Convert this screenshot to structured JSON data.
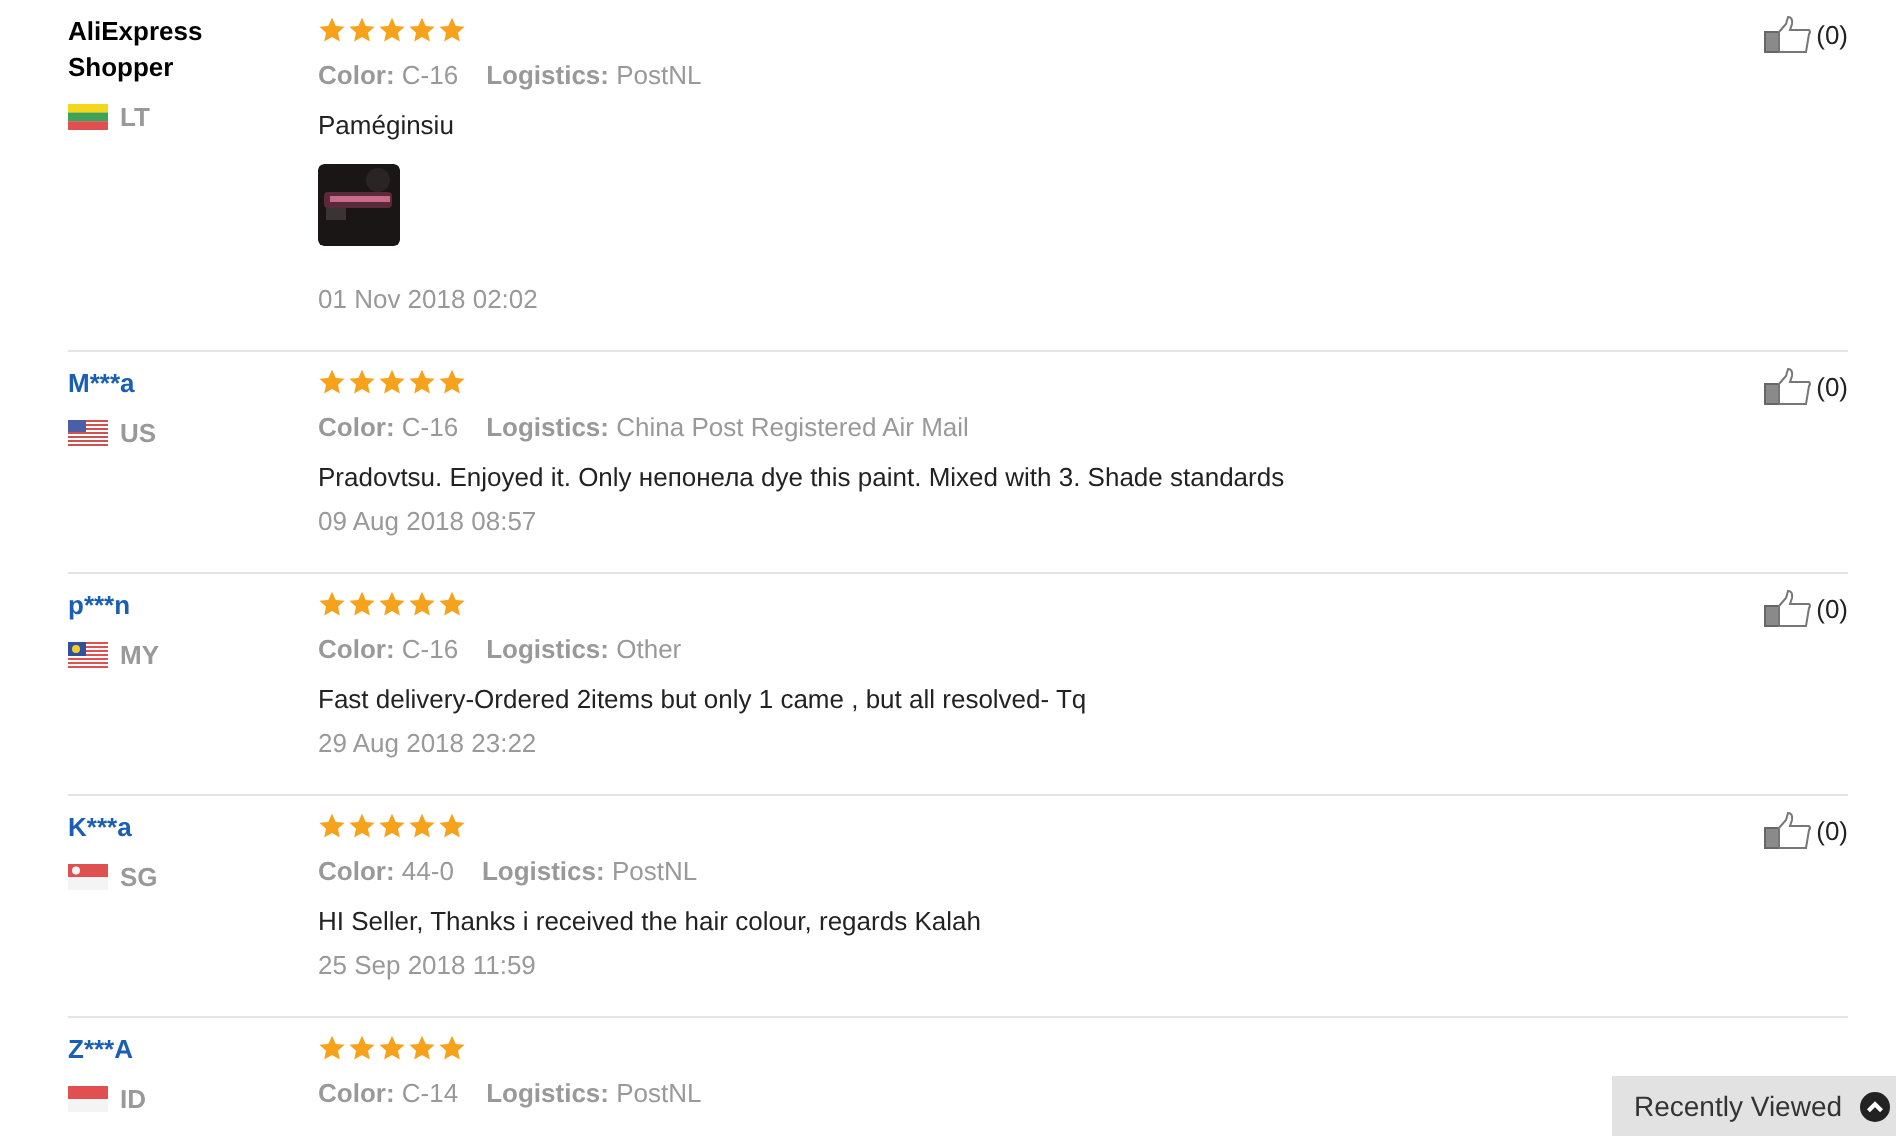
{
  "reviews": [
    {
      "name": "AliExpress Shopper",
      "linked": false,
      "country": "LT",
      "flag": {
        "kind": "lt"
      },
      "stars": 5,
      "color_label": "Color:",
      "color_value": "C-16",
      "logistics_label": "Logistics:",
      "logistics": "PostNL",
      "comment": "Paméginsiu",
      "photos": [
        {
          "kind": "picture"
        }
      ],
      "date": "01 Nov 2018 02:02",
      "likes": "(0)"
    },
    {
      "name": "M***a",
      "linked": true,
      "country": "US",
      "flag": {
        "kind": "us"
      },
      "stars": 5,
      "color_label": "Color:",
      "color_value": "C-16",
      "logistics_label": "Logistics:",
      "logistics": "China Post Registered Air Mail",
      "comment": "Pradovtsu. Enjoyed it. Only непонела dye this paint. Mixed with 3. Shade standards",
      "date": "09 Aug 2018 08:57",
      "likes": "(0)"
    },
    {
      "name": "p***n",
      "linked": true,
      "country": "MY",
      "flag": {
        "kind": "my"
      },
      "stars": 5,
      "color_label": "Color:",
      "color_value": "C-16",
      "logistics_label": "Logistics:",
      "logistics": "Other",
      "comment": "Fast delivery-Ordered 2items but only 1 came , but all resolved- Tq",
      "date": "29 Aug 2018 23:22",
      "likes": "(0)"
    },
    {
      "name": "K***a",
      "linked": true,
      "country": "SG",
      "flag": {
        "kind": "sg"
      },
      "stars": 5,
      "color_label": "Color:",
      "color_value": "44-0",
      "logistics_label": "Logistics:",
      "logistics": "PostNL",
      "comment": "HI Seller, Thanks i received the hair colour, regards Kalah",
      "date": "25 Sep 2018 11:59",
      "likes": "(0)"
    },
    {
      "name": "Z***A",
      "linked": true,
      "country": "ID",
      "flag": {
        "kind": "id"
      },
      "stars": 5,
      "color_label": "Color:",
      "color_value": "C-14",
      "logistics_label": "Logistics:",
      "logistics": "PostNL"
    }
  ],
  "recently_viewed": {
    "label": "Recently Viewed"
  }
}
